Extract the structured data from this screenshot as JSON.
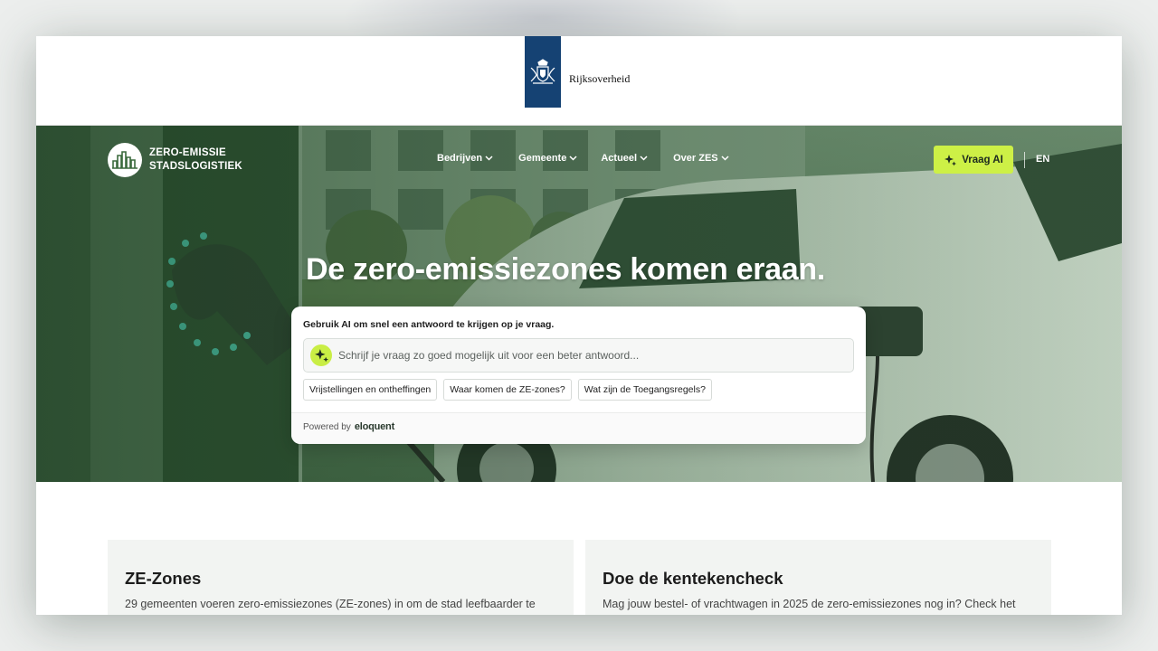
{
  "gov": {
    "name": "Rijksoverheid"
  },
  "nav": {
    "logo_line1": "ZERO-EMISSIE",
    "logo_line2": "STADSLOGISTIEK",
    "items": [
      {
        "label": "Bedrijven"
      },
      {
        "label": "Gemeente"
      },
      {
        "label": "Actueel"
      },
      {
        "label": "Over ZES"
      }
    ],
    "ai_button": "Vraag AI",
    "language": "EN"
  },
  "hero": {
    "headline": "De zero-emissiezones komen eraan."
  },
  "ai": {
    "intro": "Gebruik AI om snel een antwoord te krijgen op je vraag.",
    "placeholder": "Schrijf je vraag zo goed mogelijk uit voor een beter antwoord...",
    "value": "",
    "suggestions": [
      {
        "label": "Vrijstellingen en ontheffingen"
      },
      {
        "label": "Waar komen de ZE-zones?"
      },
      {
        "label": "Wat zijn de Toegangsregels?"
      }
    ],
    "powered_by": "Powered by",
    "provider": "eloquent"
  },
  "cards": [
    {
      "title": "ZE-Zones",
      "text": "29 gemeenten voeren zero-emissiezones (ZE-zones) in om de stad leefbaarder te"
    },
    {
      "title": "Doe de kentekencheck",
      "text": "Mag jouw bestel- of vrachtwagen in 2025 de zero-emissiezones nog in? Check het"
    }
  ],
  "colors": {
    "gov_blue": "#154273",
    "accent_lime": "#cdf046",
    "hero_green": "#2f5a34",
    "card_bg": "#f2f4f2"
  },
  "icons": {
    "gov": "royal-coat-of-arms-icon",
    "logo": "city-skyline-icon",
    "chevron": "chevron-down-icon",
    "ai": "sparkle-icon"
  }
}
